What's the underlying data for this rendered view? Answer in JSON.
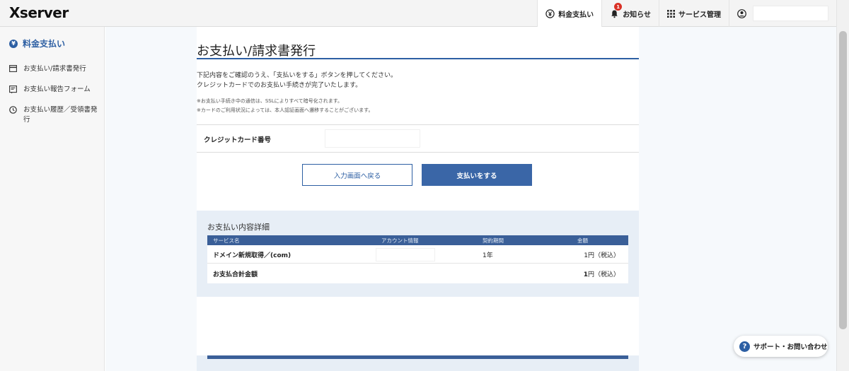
{
  "header": {
    "logo": "Xserver",
    "nav": [
      {
        "label": "料金支払い",
        "icon": "yen-circle-icon",
        "active": true
      },
      {
        "label": "お知らせ",
        "icon": "bell-icon",
        "badge": "1"
      },
      {
        "label": "サービス管理",
        "icon": "grid-icon"
      },
      {
        "label": "",
        "icon": "user-icon"
      }
    ]
  },
  "sidebar": {
    "title": "料金支払い",
    "items": [
      {
        "label": "お支払い/請求書発行",
        "icon": "card-icon"
      },
      {
        "label": "お支払い報告フォーム",
        "icon": "form-icon"
      },
      {
        "label": "お支払い履歴／受領書発行",
        "icon": "clock-icon"
      }
    ]
  },
  "main": {
    "title": "お支払い/請求書発行",
    "desc_line1": "下記内容をご確認のうえ、「支払いをする」ボタンを押してください。",
    "desc_line2": "クレジットカードでのお支払い手続きが完了いたします。",
    "note_line1": "※お支払い手続き中の通信は、SSLによりすべて暗号化されます。",
    "note_line2": "※カードのご利用状況によっては、本人認証画面へ遷移することがございます。",
    "card_label": "クレジットカード番号",
    "back_button": "入力画面へ戻る",
    "pay_button": "支払いをする"
  },
  "details": {
    "title": "お支払い内容詳細",
    "headers": [
      "サービス名",
      "アカウント情報",
      "契約期間",
      "金額"
    ],
    "rows": [
      {
        "service": "ドメイン新規取得／(com)",
        "period": "1年",
        "amount": "1円（税込）"
      }
    ],
    "total_label": "お支払合計金額",
    "total_amount_num": "1",
    "total_amount_unit": "円（税込）"
  },
  "support": {
    "label": "サポート・お問い合わせ"
  },
  "colors": {
    "accent": "#2d5fa3",
    "table_header": "#3a5f98",
    "panel_bg": "#e7eef6"
  }
}
